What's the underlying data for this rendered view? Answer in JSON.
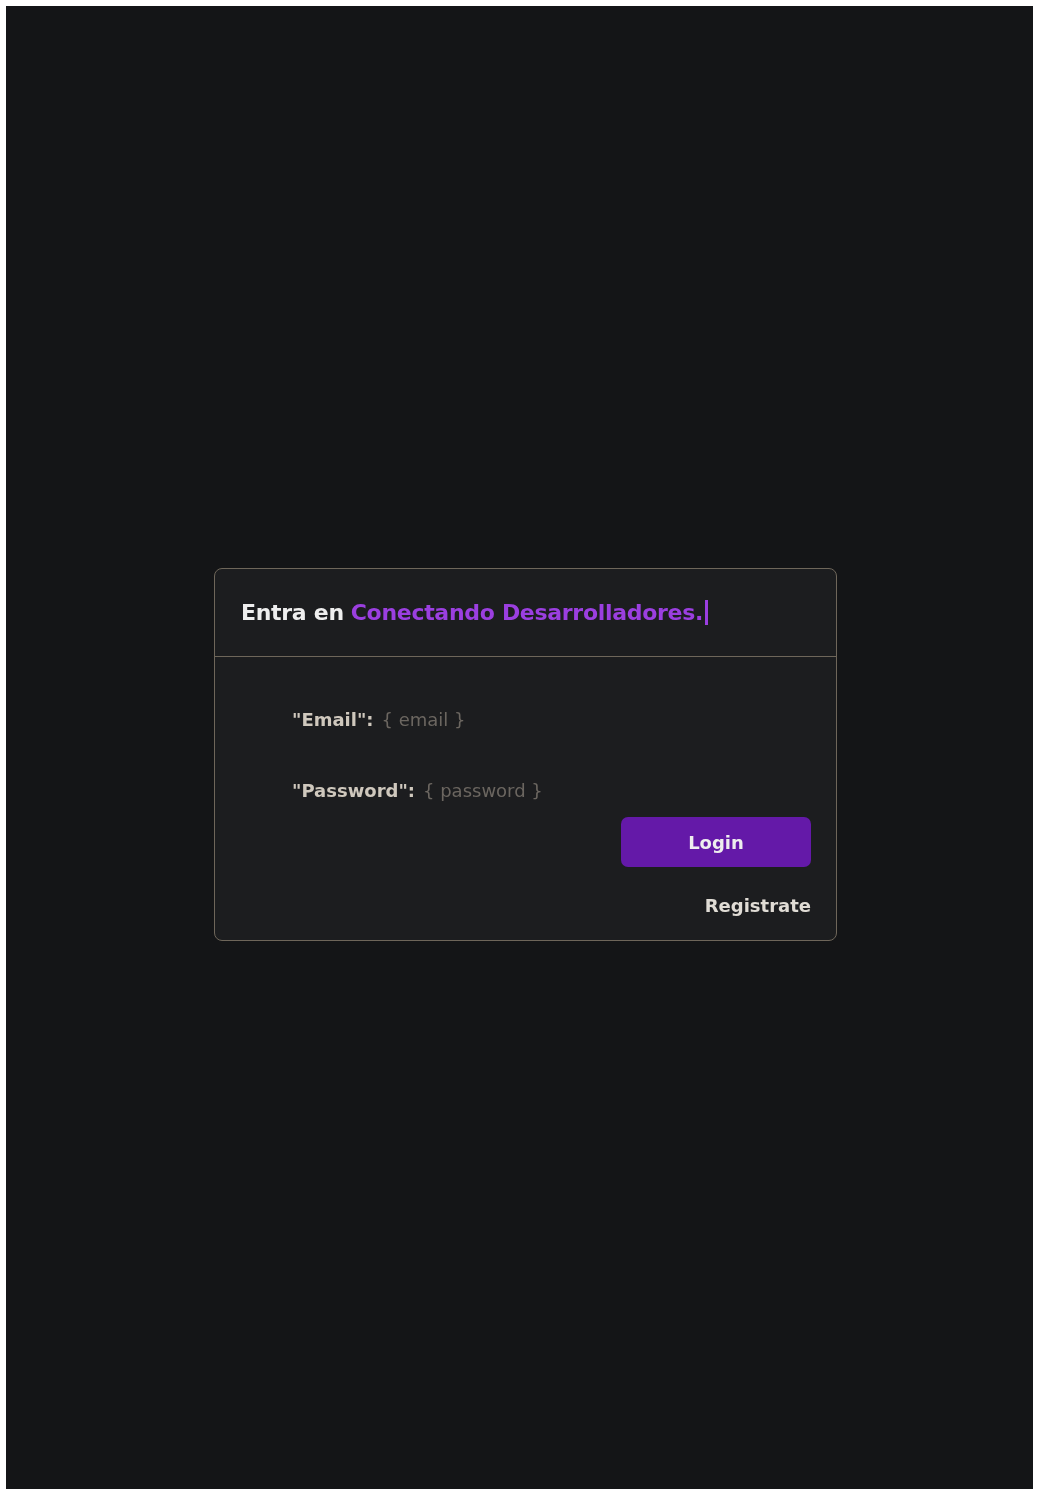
{
  "card": {
    "title_prefix": "Entra en",
    "title_highlight": "Conectando Desarrolladores.",
    "caret": true
  },
  "fields": [
    {
      "label": "\"Email\":",
      "placeholder": "{ email }"
    },
    {
      "label": "\"Password\":",
      "placeholder": "{ password }"
    }
  ],
  "login_button": "Login",
  "register_link": "Registrate"
}
